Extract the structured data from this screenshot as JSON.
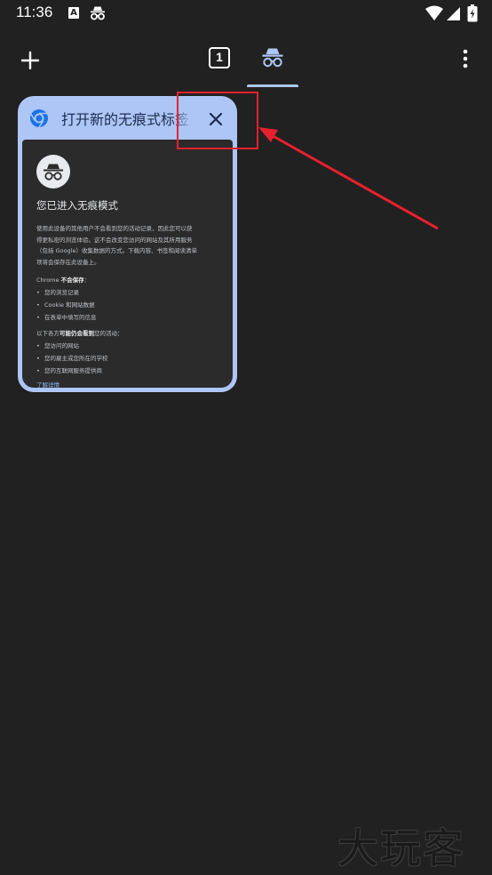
{
  "status_bar": {
    "time": "11:36",
    "icons": [
      "accessibility-a-icon",
      "incognito-icon",
      "wifi-icon",
      "signal-icon",
      "battery-icon"
    ]
  },
  "toolbar": {
    "new_tab_icon": "plus-icon",
    "tab_count": "1",
    "incognito_tab_icon": "incognito-icon",
    "menu_icon": "more-vertical-icon",
    "accent_color": "#aec6f6"
  },
  "tab_card": {
    "title": "打开新的无痕式标签页",
    "favicon": "chrome-icon",
    "close_icon": "close-icon",
    "card_color": "#aec6f6",
    "preview": {
      "heading": "您已进入无痕模式",
      "intro_lines": [
        "使用此设备的其他用户不会看到您的活动记录，因此您可以获",
        "得更私密的浏览体验。这不会改变您访问的网站及其所用服务",
        "（包括 Google）收集数据的方式。下载内容、书签和阅读清单",
        "项将会保存在此设备上。"
      ],
      "not_saved_prefix": "Chrome ",
      "not_saved_bold": "不会保存",
      "not_saved_suffix": "：",
      "not_saved_items": [
        "您的浏览记录",
        "Cookie 和网站数据",
        "在表单中填写的信息"
      ],
      "visible_prefix": "以下各方",
      "visible_bold": "可能仍会看到",
      "visible_suffix": "您的活动：",
      "visible_items": [
        "您访问的网站",
        "您的雇主或您所在的学校",
        "您的互联网服务提供商"
      ],
      "learn_more": "了解详情"
    }
  },
  "annotation": {
    "color": "#e8212e"
  },
  "watermark": "大玩客"
}
